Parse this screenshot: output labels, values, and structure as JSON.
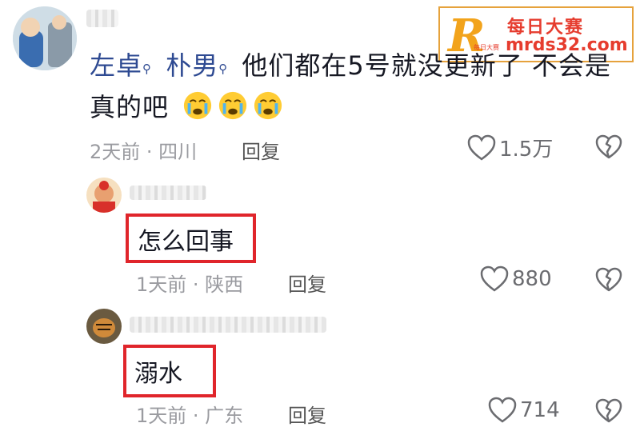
{
  "watermark": {
    "mark": "R",
    "cn": "每日大赛",
    "url": "mrds32.com",
    "small": "每日大赛"
  },
  "comment1": {
    "mention1": "左卓",
    "mention2": "朴男",
    "text_line1": "他们都在5号就没更新了 不会是",
    "text_line2": "真的吧",
    "meta": "2天前 · 四川",
    "reply_label": "回复",
    "likes": "1.5万"
  },
  "reply1": {
    "text": "怎么回事",
    "meta": "1天前 · 陕西",
    "reply_label": "回复",
    "likes": "880"
  },
  "reply2": {
    "text": "溺水",
    "meta": "1天前 · 广东",
    "reply_label": "回复",
    "likes": "714"
  },
  "colors": {
    "highlight": "#e0252b",
    "mention": "#2e4a92",
    "meta": "#9a9ba0"
  }
}
